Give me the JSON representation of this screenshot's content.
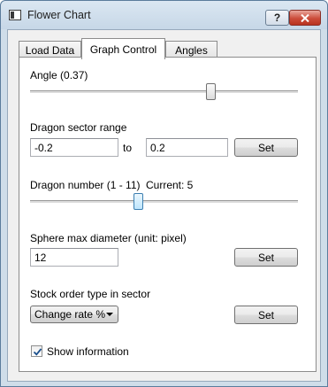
{
  "window": {
    "title": "Flower Chart",
    "help_label": "?"
  },
  "tabs": [
    {
      "label": "Load Data",
      "active": false
    },
    {
      "label": "Graph Control",
      "active": true
    },
    {
      "label": "Angles",
      "active": false
    }
  ],
  "angle": {
    "label": "Angle (0.37)",
    "slider_fraction": 0.68
  },
  "dragon_sector": {
    "label": "Dragon sector range",
    "from_value": "-0.2",
    "to_label": "to",
    "to_value": "0.2",
    "set_label": "Set"
  },
  "dragon_number": {
    "label": "Dragon number (1 - 11)",
    "current_label": "Current: 5",
    "min": 1,
    "max": 11,
    "value": 5
  },
  "sphere": {
    "label": "Sphere max diameter (unit: pixel)",
    "value": "12",
    "set_label": "Set"
  },
  "stock_order": {
    "label": "Stock order type in sector",
    "selected": "Change rate %",
    "set_label": "Set"
  },
  "show_info": {
    "label": "Show information",
    "checked": true
  },
  "colors": {
    "frame": "#cfdde9",
    "close_button": "#cc4d3a",
    "focus_accent": "#3c7fb1"
  }
}
